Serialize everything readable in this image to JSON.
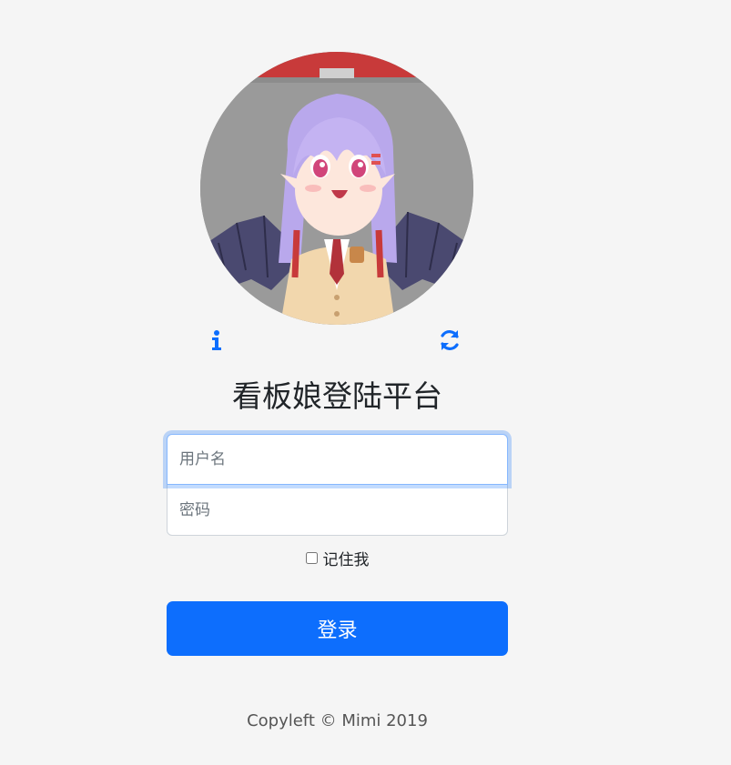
{
  "login": {
    "title": "看板娘登陆平台",
    "username_placeholder": "用户名",
    "password_placeholder": "密码",
    "remember_label": "记住我",
    "submit_label": "登录"
  },
  "icons": {
    "info": "info-icon",
    "refresh": "refresh-icon",
    "accent_color": "#0d6efd"
  },
  "footer": {
    "text": "Copyleft © Mimi 2019"
  }
}
